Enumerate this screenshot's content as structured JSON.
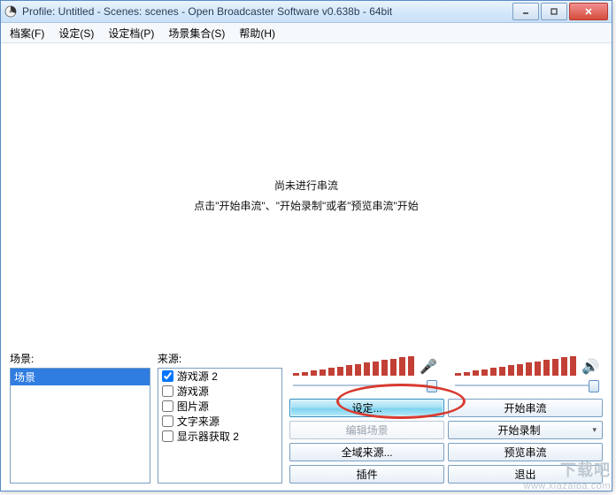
{
  "title": "Profile: Untitled - Scenes: scenes - Open Broadcaster Software v0.638b - 64bit",
  "menubar": {
    "file": "档案(F)",
    "settings": "设定(S)",
    "profiles": "设定档(P)",
    "scene_collection": "场景集合(S)",
    "help": "帮助(H)"
  },
  "preview": {
    "line1": "尚未进行串流",
    "line2": "点击\"开始串流\"、\"开始录制\"或者\"预览串流\"开始"
  },
  "scenes": {
    "label": "场景:",
    "items": [
      "场景"
    ],
    "selected_index": 0
  },
  "sources": {
    "label": "来源:",
    "items": [
      {
        "label": "游戏源 2",
        "checked": true
      },
      {
        "label": "游戏源",
        "checked": false
      },
      {
        "label": "图片源",
        "checked": false
      },
      {
        "label": "文字来源",
        "checked": false
      },
      {
        "label": "显示器获取 2",
        "checked": false
      }
    ]
  },
  "meter_icons": {
    "mic": "🎤",
    "speaker": "🔊"
  },
  "buttons": {
    "settings": "设定...",
    "start_stream": "开始串流",
    "edit_scene": "编辑场景",
    "start_record": "开始录制",
    "global_sources": "全域来源...",
    "preview_stream": "预览串流",
    "plugins": "插件",
    "exit": "退出"
  },
  "arrow": "▾",
  "watermark": {
    "big": "下载吧",
    "small": "www.xiazaiba.com"
  }
}
